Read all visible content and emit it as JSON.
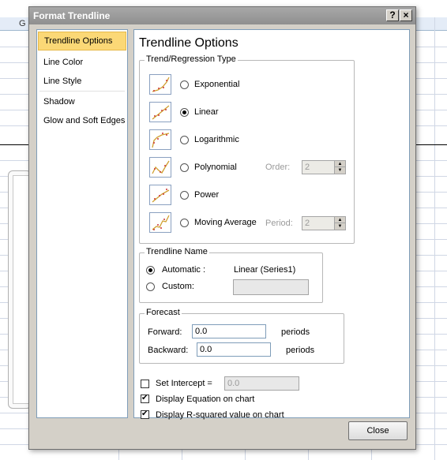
{
  "sheet": {
    "column_letter": "G"
  },
  "dialog": {
    "title": "Format Trendline",
    "help_label": "?",
    "close_x_label": "×",
    "close_button_label": "Close"
  },
  "nav": {
    "items": [
      {
        "label": "Trendline Options",
        "selected": true
      },
      {
        "label": "Line Color"
      },
      {
        "label": "Line Style"
      },
      {
        "label": "Shadow"
      },
      {
        "label": "Glow and Soft Edges"
      }
    ]
  },
  "pane": {
    "title": "Trendline Options",
    "type_group": {
      "legend": "Trend/Regression Type",
      "options": [
        {
          "label": "Exponential",
          "icon": "exponential-trend-icon",
          "selected": false
        },
        {
          "label": "Linear",
          "icon": "linear-trend-icon",
          "selected": true
        },
        {
          "label": "Logarithmic",
          "icon": "logarithmic-trend-icon",
          "selected": false
        },
        {
          "label": "Polynomial",
          "icon": "polynomial-trend-icon",
          "selected": false
        },
        {
          "label": "Power",
          "icon": "power-trend-icon",
          "selected": false
        },
        {
          "label": "Moving Average",
          "icon": "moving-average-trend-icon",
          "selected": false
        }
      ],
      "order_label": "Order:",
      "order_value": "2",
      "period_label": "Period:",
      "period_value": "2"
    },
    "name_group": {
      "legend": "Trendline Name",
      "automatic_label": "Automatic :",
      "automatic_value": "Linear (Series1)",
      "custom_label": "Custom:",
      "custom_value": ""
    },
    "forecast_group": {
      "legend": "Forecast",
      "forward_label": "Forward:",
      "forward_value": "0.0",
      "forward_unit": "periods",
      "backward_label": "Backward:",
      "backward_value": "0.0",
      "backward_unit": "periods"
    },
    "checks": {
      "intercept_label": "Set Intercept =",
      "intercept_value": "0.0",
      "intercept_checked": false,
      "equation_label": "Display Equation on chart",
      "equation_checked": true,
      "rsquared_label": "Display R-squared value on chart",
      "rsquared_checked": true
    }
  },
  "colors": {
    "selected_nav": "#fbd876",
    "trend_line": "#d0a030",
    "data_points": "#cc3333"
  }
}
